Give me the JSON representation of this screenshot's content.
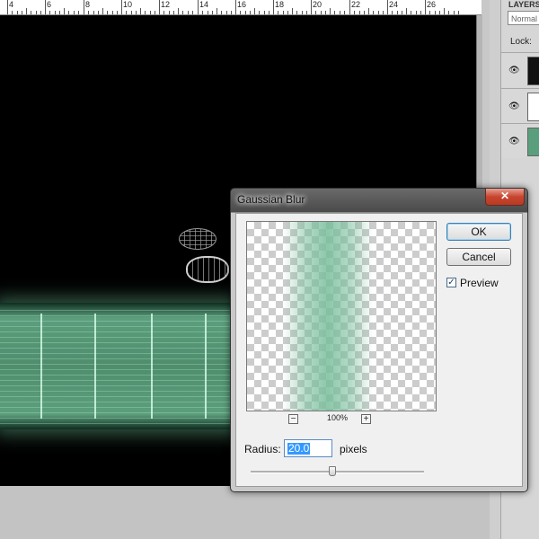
{
  "ruler": {
    "labels": [
      "4",
      "6",
      "8",
      "10",
      "12",
      "14",
      "16",
      "18",
      "20",
      "22",
      "24",
      "26"
    ]
  },
  "layers_panel": {
    "title": "LAYERS",
    "blend_mode": "Normal",
    "lock_label": "Lock:",
    "layers": [
      {
        "visible_icon": "eye-icon",
        "thumb_color": "#111111"
      },
      {
        "visible_icon": "eye-icon",
        "thumb_color": "#ffffff"
      },
      {
        "visible_icon": "eye-icon",
        "thumb_color": "#5a9f7d"
      }
    ]
  },
  "dialog": {
    "title": "Gaussian Blur",
    "close_label": "✕",
    "ok_label": "OK",
    "cancel_label": "Cancel",
    "preview_label": "Preview",
    "preview_checked": true,
    "zoom_out_label": "−",
    "zoom_in_label": "+",
    "zoom_level": "100%",
    "radius_label": "Radius:",
    "radius_value": "20.0",
    "radius_unit": "pixels",
    "radius_slider_fraction": 0.47
  },
  "colors": {
    "canvas": "#000000",
    "glow_green": "#5c9f7d",
    "selection_blue": "#3399ff",
    "close_red": "#c8452f"
  }
}
